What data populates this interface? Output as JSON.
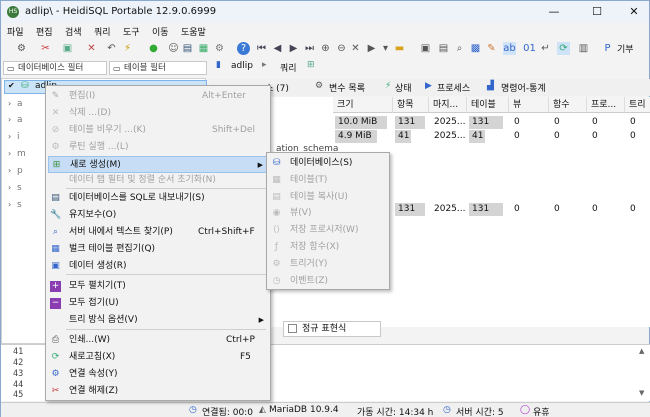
{
  "window": {
    "title": "adlip\\ - HeidiSQL Portable 12.9.0.6999"
  },
  "menubar": [
    "파일",
    "편집",
    "검색",
    "쿼리",
    "도구",
    "이동",
    "도움말"
  ],
  "filters": {
    "db_filter": "데이터베이스 필터",
    "table_filter": "테이블 필터"
  },
  "top_tabs": {
    "db": "adlip",
    "query": "쿼리"
  },
  "tree": {
    "selected": "adlip"
  },
  "main_tabs": [
    "스 (7)",
    "변수 목록",
    "상태",
    "프로세스",
    "명령어-통계"
  ],
  "grid": {
    "headers": [
      "크기",
      "항목",
      "마지...",
      "테이블",
      "뷰",
      "함수",
      "프로...",
      "트리"
    ],
    "rows": [
      [
        "10.0 MiB",
        "131",
        "2025...",
        "131",
        "0",
        "0",
        "0",
        "0"
      ],
      [
        "4.9 MiB",
        "41",
        "2025...",
        "41",
        "0",
        "0",
        "0",
        "0"
      ],
      [
        "",
        "131",
        "2025...",
        "131",
        "0",
        "0",
        "0",
        "0"
      ]
    ],
    "partial_text": "ation_schema"
  },
  "regex_label": "정규 표현식",
  "log_lines": [
    "41",
    "42",
    "43",
    "44",
    "45"
  ],
  "status": {
    "connected": "연결됨: 00:0",
    "server": "MariaDB 10.9.4",
    "uptime": "가동 시간: 14:34 h",
    "server_time": "서버 시간: 5",
    "idle": "유휴"
  },
  "context_menu": [
    {
      "label": "편집(I)",
      "shortcut": "Alt+Enter",
      "disabled": true,
      "icon": "edit-icon"
    },
    {
      "label": "삭제 ...(D)",
      "shortcut": "",
      "disabled": true,
      "icon": "delete-icon"
    },
    {
      "label": "테이블 비우기 ...(K)",
      "shortcut": "Shift+Del",
      "disabled": true,
      "icon": "empty-table-icon"
    },
    {
      "label": "루틴 실행 ...(L)",
      "shortcut": "",
      "disabled": true,
      "icon": "run-routine-icon"
    },
    {
      "label": "새로 생성(M)",
      "shortcut": "",
      "disabled": false,
      "icon": "new-icon",
      "submenu": true,
      "highlight": true
    },
    {
      "label": "데이터 탭 필터 및 정렬 순서 초기화(N)",
      "shortcut": "",
      "disabled": true,
      "icon": ""
    },
    {
      "label": "데이터베이스를 SQL로 내보내기(S)",
      "shortcut": "",
      "disabled": false,
      "icon": "export-sql-icon"
    },
    {
      "label": "유지보수(O)",
      "shortcut": "",
      "disabled": false,
      "icon": "maintenance-icon"
    },
    {
      "label": "서버 내에서 텍스트 찾기(P)",
      "shortcut": "Ctrl+Shift+F",
      "disabled": false,
      "icon": "search-icon"
    },
    {
      "label": "벌크 테이블 편집기(Q)",
      "shortcut": "",
      "disabled": false,
      "icon": "bulk-edit-icon"
    },
    {
      "label": "데이터 생성(R)",
      "shortcut": "",
      "disabled": false,
      "icon": "generate-data-icon"
    },
    {
      "label": "모두 펼치기(T)",
      "shortcut": "",
      "disabled": false,
      "icon": "expand-all-icon"
    },
    {
      "label": "모두 접기(U)",
      "shortcut": "",
      "disabled": false,
      "icon": "collapse-all-icon"
    },
    {
      "label": "트리 방식 옵션(V)",
      "shortcut": "",
      "disabled": false,
      "icon": "",
      "submenu": true
    },
    {
      "label": "인쇄...(W)",
      "shortcut": "Ctrl+P",
      "disabled": false,
      "icon": "print-icon"
    },
    {
      "label": "새로고침(X)",
      "shortcut": "F5",
      "disabled": false,
      "icon": "refresh-icon"
    },
    {
      "label": "연결 속성(Y)",
      "shortcut": "",
      "disabled": false,
      "icon": "connection-props-icon"
    },
    {
      "label": "연결 해제(Z)",
      "shortcut": "",
      "disabled": false,
      "icon": "disconnect-icon"
    }
  ],
  "submenu": [
    {
      "label": "데이터베이스(S)",
      "disabled": false,
      "icon": "database-icon"
    },
    {
      "label": "테이블(T)",
      "disabled": true,
      "icon": "table-icon"
    },
    {
      "label": "테이블 복사(U)",
      "disabled": true,
      "icon": "copy-table-icon"
    },
    {
      "label": "뷰(V)",
      "disabled": true,
      "icon": "view-icon"
    },
    {
      "label": "저장 프로시저(W)",
      "disabled": true,
      "icon": "procedure-icon"
    },
    {
      "label": "저장 함수(X)",
      "disabled": true,
      "icon": "function-icon"
    },
    {
      "label": "트리거(Y)",
      "disabled": true,
      "icon": "trigger-icon"
    },
    {
      "label": "이벤트(Z)",
      "disabled": true,
      "icon": "event-icon"
    }
  ]
}
